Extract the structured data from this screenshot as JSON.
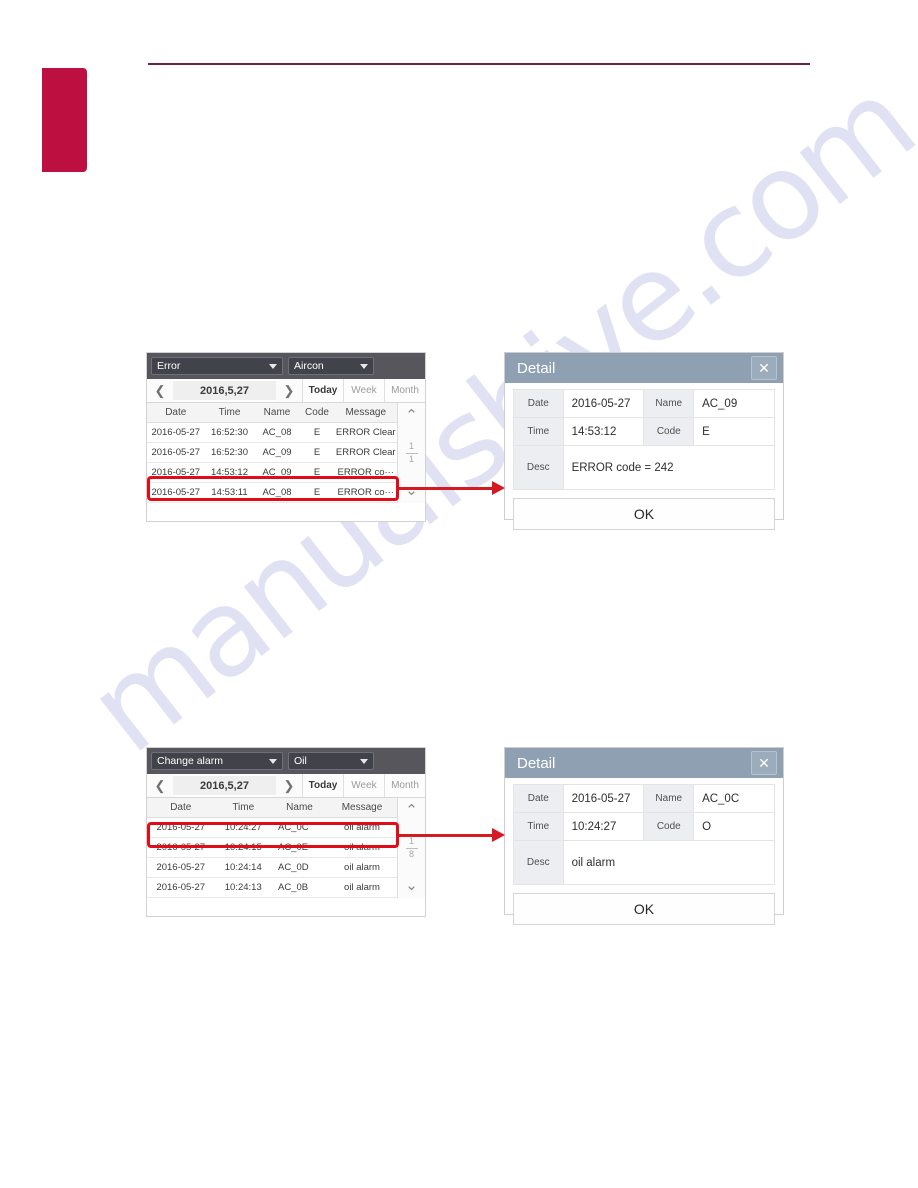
{
  "page": {
    "watermark_text": "manualshive.com",
    "accent_red": "#be1040",
    "rule_color": "#6b2050",
    "highlight_color": "#e00c18",
    "dialog_title_color": "#8fa0b2"
  },
  "figure_top": {
    "list_panel": {
      "selectors": [
        {
          "label": "Error",
          "icon": "chevron-down-icon"
        },
        {
          "label": "Aircon",
          "icon": "chevron-down-icon"
        }
      ],
      "nav": {
        "prev_icon": "chevron-left-icon",
        "next_icon": "chevron-right-icon",
        "date": "2016,5,27",
        "ranges": [
          {
            "label": "Today",
            "active": true
          },
          {
            "label": "Week",
            "active": false
          },
          {
            "label": "Month",
            "active": false
          }
        ]
      },
      "columns": [
        "Date",
        "Time",
        "Name",
        "Code",
        "Message"
      ],
      "rows": [
        {
          "date": "2016-05-27",
          "time": "16:52:30",
          "name": "AC_08",
          "code": "E",
          "message": "ERROR Clear",
          "selected": false
        },
        {
          "date": "2016-05-27",
          "time": "16:52:30",
          "name": "AC_09",
          "code": "E",
          "message": "ERROR Clear",
          "selected": false
        },
        {
          "date": "2016-05-27",
          "time": "14:53:12",
          "name": "AC_09",
          "code": "E",
          "message": "ERROR co···",
          "selected": true
        },
        {
          "date": "2016-05-27",
          "time": "14:53:11",
          "name": "AC_08",
          "code": "E",
          "message": "ERROR co···",
          "selected": false
        }
      ],
      "rail": {
        "up_icon": "chevron-up-icon",
        "down_icon": "chevron-down-icon",
        "page_current": "1",
        "page_total": "1"
      }
    },
    "detail_dialog": {
      "title": "Detail",
      "close_icon": "close-icon",
      "fields": {
        "date_label": "Date",
        "date_value": "2016-05-27",
        "name_label": "Name",
        "name_value": "AC_09",
        "time_label": "Time",
        "time_value": "14:53:12",
        "code_label": "Code",
        "code_value": "E",
        "desc_label": "Desc",
        "desc_value": "ERROR code = 242"
      },
      "ok_label": "OK"
    }
  },
  "figure_bottom": {
    "list_panel": {
      "selectors": [
        {
          "label": "Change alarm",
          "icon": "chevron-down-icon"
        },
        {
          "label": "Oil",
          "icon": "chevron-down-icon"
        }
      ],
      "nav": {
        "prev_icon": "chevron-left-icon",
        "next_icon": "chevron-right-icon",
        "date": "2016,5,27",
        "ranges": [
          {
            "label": "Today",
            "active": true
          },
          {
            "label": "Week",
            "active": false
          },
          {
            "label": "Month",
            "active": false
          }
        ]
      },
      "columns": [
        "Date",
        "Time",
        "Name",
        "Message"
      ],
      "rows": [
        {
          "date": "2016-05-27",
          "time": "10:24:27",
          "name": "AC_0C",
          "message": "oil alarm",
          "selected": true
        },
        {
          "date": "2016-05-27",
          "time": "10:24:15",
          "name": "AC_0E",
          "message": "oil alarm",
          "selected": false
        },
        {
          "date": "2016-05-27",
          "time": "10:24:14",
          "name": "AC_0D",
          "message": "oil alarm",
          "selected": false
        },
        {
          "date": "2016-05-27",
          "time": "10:24:13",
          "name": "AC_0B",
          "message": "oil alarm",
          "selected": false
        }
      ],
      "rail": {
        "up_icon": "chevron-up-icon",
        "down_icon": "chevron-down-icon",
        "page_current": "1",
        "page_total": "8"
      }
    },
    "detail_dialog": {
      "title": "Detail",
      "close_icon": "close-icon",
      "fields": {
        "date_label": "Date",
        "date_value": "2016-05-27",
        "name_label": "Name",
        "name_value": "AC_0C",
        "time_label": "Time",
        "time_value": "10:24:27",
        "code_label": "Code",
        "code_value": "O",
        "desc_label": "Desc",
        "desc_value": "oil alarm"
      },
      "ok_label": "OK"
    }
  }
}
